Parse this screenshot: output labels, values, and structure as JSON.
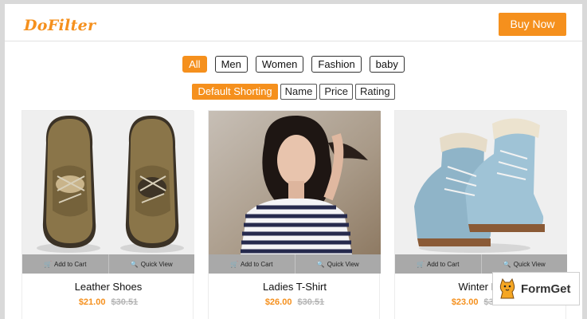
{
  "header": {
    "logo": "DoFilter",
    "buy_label": "Buy Now"
  },
  "filters": [
    {
      "label": "All",
      "active": true
    },
    {
      "label": "Men",
      "active": false
    },
    {
      "label": "Women",
      "active": false
    },
    {
      "label": "Fashion",
      "active": false
    },
    {
      "label": "baby",
      "active": false
    }
  ],
  "sorting": [
    {
      "label": "Default Shorting",
      "active": true
    },
    {
      "label": "Name",
      "active": false
    },
    {
      "label": "Price",
      "active": false
    },
    {
      "label": "Rating",
      "active": false
    }
  ],
  "products": [
    {
      "name": "Leather Shoes",
      "price": "$21.00",
      "old_price": "$30.51",
      "add_label": "Add to Cart",
      "view_label": "Quick View"
    },
    {
      "name": "Ladies T-Shirt",
      "price": "$26.00",
      "old_price": "$30.51",
      "add_label": "Add to Cart",
      "view_label": "Quick View"
    },
    {
      "name": "Winter Bo",
      "price": "$23.00",
      "old_price": "$30.51",
      "add_label": "Add to Cart",
      "view_label": "Quick View"
    }
  ],
  "badge": {
    "label": "FormGet"
  },
  "colors": {
    "accent": "#f5901d",
    "action_bar": "#a9a9a9"
  }
}
